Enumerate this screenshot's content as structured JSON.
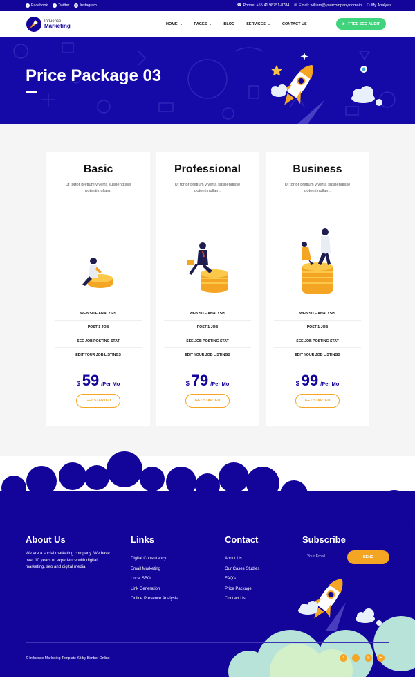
{
  "topbar": {
    "social": [
      {
        "icon": "facebook-icon",
        "label": "Facebook"
      },
      {
        "icon": "twitter-icon",
        "label": "Twitter"
      },
      {
        "icon": "instagram-icon",
        "label": "Instagram"
      }
    ],
    "phone": "Phone: +55 41 98751-8784",
    "email": "Email: william@yourcompany.domain",
    "account": "My Analysis"
  },
  "brand": {
    "line1": "Influence",
    "line2": "Marketing"
  },
  "nav": {
    "items": [
      {
        "label": "HOME",
        "caret": true
      },
      {
        "label": "PAGES",
        "caret": true
      },
      {
        "label": "BLOG",
        "caret": false
      },
      {
        "label": "SERVICES",
        "caret": true
      },
      {
        "label": "CONTACT US",
        "caret": false
      }
    ],
    "cta": "FREE SEO AUDIT"
  },
  "hero": {
    "title": "Price Package 03"
  },
  "plans": [
    {
      "name": "Basic",
      "desc": "Ut tortor pretium viverra suspendisse potenti nullam.",
      "features": [
        "WEB SITE ANALYSIS",
        "POST 1 JOB",
        "SEE JOB POSTING STAT",
        "EDIT YOUR JOB LISTINGS"
      ],
      "currency": "$",
      "price": "59",
      "period": "/Per Mo",
      "button": "GET STARTED"
    },
    {
      "name": "Professional",
      "desc": "Ut tortor pretium viverra suspendisse potenti nullam.",
      "features": [
        "WEB SITE ANALYSIS",
        "POST 1 JOB",
        "SEE JOB POSTING STAT",
        "EDIT YOUR JOB LISTINGS"
      ],
      "currency": "$",
      "price": "79",
      "period": "/Per Mo",
      "button": "GET STARTED"
    },
    {
      "name": "Business",
      "desc": "Ut tortor pretium viverra suspendisse potenti nullam.",
      "features": [
        "WEB SITE ANALYSIS",
        "POST 1 JOB",
        "SEE JOB POSTING STAT",
        "EDIT YOUR JOB LISTINGS"
      ],
      "currency": "$",
      "price": "99",
      "period": "/Per Mo",
      "button": "GET STARTED"
    }
  ],
  "footer": {
    "about_title": "About Us",
    "about_text": "We are a social marketing company. We have over 10 years of experience with digital marketing, seo and digital media.",
    "links_title": "Links",
    "links": [
      "Digital Consultancy",
      "Email Marketing",
      "Local SEO",
      "Link Generation",
      "Online Presence Analysis"
    ],
    "contact_title": "Contact",
    "contact": [
      "About Us",
      "Our Cases Studies",
      "FAQ's",
      "Price Package",
      "Contact Us"
    ],
    "subscribe_title": "Subscribe",
    "email_placeholder": "Your Email",
    "send": "SEND",
    "copyright": "© Influence Marketing Template Kit by Bimber Online",
    "socials": [
      {
        "icon": "facebook-icon",
        "glyph": "f"
      },
      {
        "icon": "twitter-icon",
        "glyph": "t"
      },
      {
        "icon": "instagram-icon",
        "glyph": "◎"
      },
      {
        "icon": "youtube-icon",
        "glyph": "▶"
      }
    ]
  },
  "colors": {
    "primary": "#13049a",
    "accent": "#f5a524",
    "cta": "#3fd37c"
  }
}
